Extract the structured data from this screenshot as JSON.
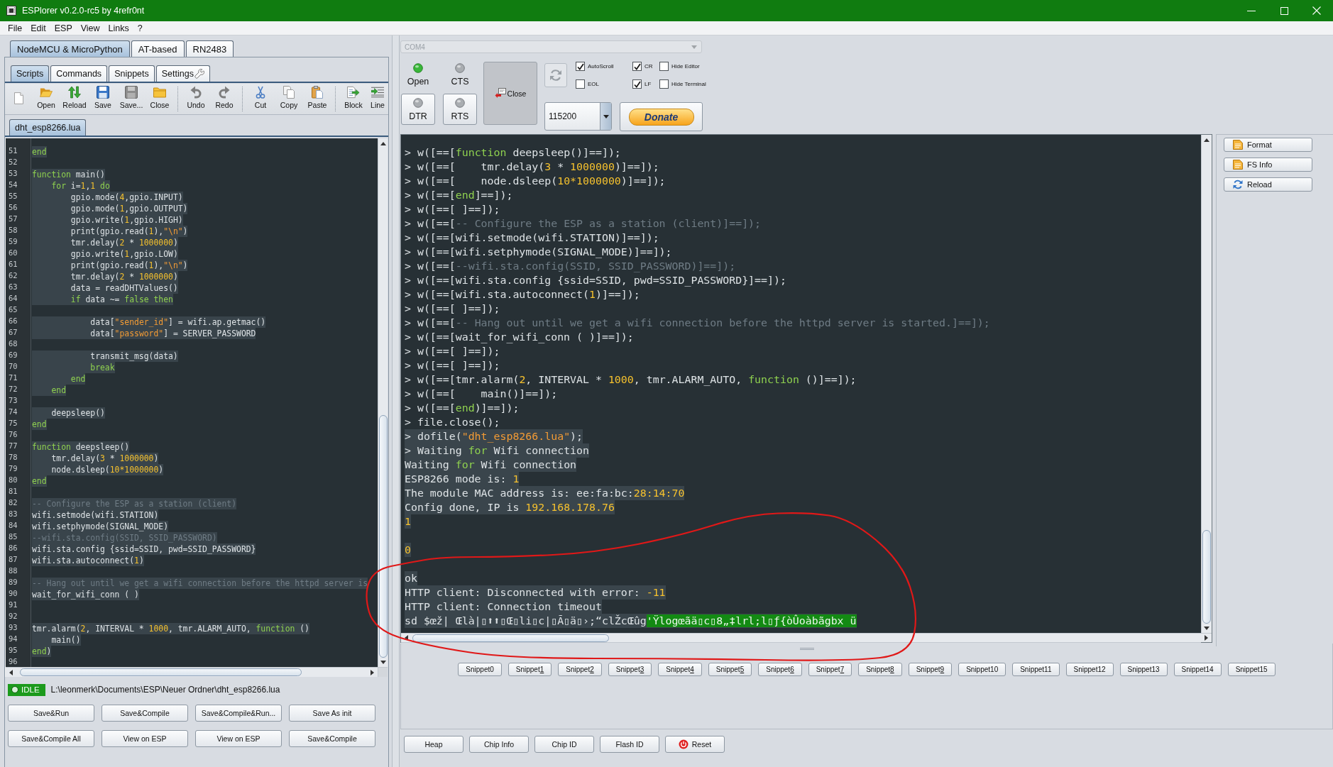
{
  "window": {
    "title": "ESPlorer v0.2.0-rc5 by 4refr0nt"
  },
  "menu": [
    "File",
    "Edit",
    "ESP",
    "View",
    "Links",
    "?"
  ],
  "firmware_tabs": [
    {
      "label": "NodeMCU & MicroPython",
      "selected": true
    },
    {
      "label": "AT-based",
      "selected": false
    },
    {
      "label": "RN2483",
      "selected": false
    }
  ],
  "editor_tabs": [
    {
      "label": "Scripts",
      "selected": true,
      "kind": "text"
    },
    {
      "label": "Commands",
      "selected": false,
      "kind": "text"
    },
    {
      "label": "Snippets",
      "selected": false,
      "kind": "text"
    },
    {
      "label": "Settings",
      "selected": false,
      "kind": "icon"
    }
  ],
  "toolbar": [
    [
      "Open",
      "Reload",
      "Save",
      "Save...",
      "Close"
    ],
    [
      "Undo",
      "Redo"
    ],
    [
      "Cut",
      "Copy",
      "Paste"
    ],
    [
      "Block",
      "Line"
    ]
  ],
  "file_tabs": [
    {
      "label": "dht_esp8266.lua",
      "selected": true
    }
  ],
  "editor": {
    "lines": [
      {
        "number": "51",
        "tokens": [
          {
            "kind": "keyword",
            "text": "end"
          }
        ]
      },
      {
        "number": "52"
      },
      {
        "number": "53",
        "tokens": [
          {
            "kind": "keyword",
            "text": "function"
          },
          {
            "kind": "plain",
            "text": " main()"
          }
        ]
      },
      {
        "number": "54",
        "tokens": [
          {
            "kind": "keyword",
            "text": "    for"
          },
          {
            "kind": "plain",
            "text": " i="
          },
          {
            "kind": "number",
            "text": "1"
          },
          {
            "kind": "plain",
            "text": ","
          },
          {
            "kind": "number",
            "text": "1"
          },
          {
            "kind": "keyword",
            "text": " do"
          }
        ]
      },
      {
        "number": "55",
        "tokens": [
          {
            "kind": "plain",
            "text": "        gpio.mode("
          },
          {
            "kind": "number",
            "text": "4"
          },
          {
            "kind": "plain",
            "text": ",gpio.INPUT)"
          }
        ]
      },
      {
        "number": "56",
        "tokens": [
          {
            "kind": "plain",
            "text": "        gpio.mode("
          },
          {
            "kind": "number",
            "text": "1"
          },
          {
            "kind": "plain",
            "text": ",gpio.OUTPUT)"
          }
        ]
      },
      {
        "number": "57",
        "tokens": [
          {
            "kind": "plain",
            "text": "        gpio.write("
          },
          {
            "kind": "number",
            "text": "1"
          },
          {
            "kind": "plain",
            "text": ",gpio.HIGH)"
          }
        ]
      },
      {
        "number": "58",
        "tokens": [
          {
            "kind": "plain",
            "text": "        print(gpio.read("
          },
          {
            "kind": "number",
            "text": "1"
          },
          {
            "kind": "plain",
            "text": "),"
          },
          {
            "kind": "string",
            "text": "\"\\n\""
          },
          {
            "kind": "plain",
            "text": ")"
          }
        ]
      },
      {
        "number": "59",
        "tokens": [
          {
            "kind": "plain",
            "text": "        tmr.delay("
          },
          {
            "kind": "number",
            "text": "2"
          },
          {
            "kind": "plain",
            "text": " * "
          },
          {
            "kind": "number",
            "text": "1000000"
          },
          {
            "kind": "plain",
            "text": ")"
          }
        ]
      },
      {
        "number": "60",
        "tokens": [
          {
            "kind": "plain",
            "text": "        gpio.write("
          },
          {
            "kind": "number",
            "text": "1"
          },
          {
            "kind": "plain",
            "text": ",gpio.LOW)"
          }
        ]
      },
      {
        "number": "61",
        "tokens": [
          {
            "kind": "plain",
            "text": "        print(gpio.read("
          },
          {
            "kind": "number",
            "text": "1"
          },
          {
            "kind": "plain",
            "text": "),"
          },
          {
            "kind": "string",
            "text": "\"\\n\""
          },
          {
            "kind": "plain",
            "text": ")"
          }
        ]
      },
      {
        "number": "62",
        "tokens": [
          {
            "kind": "plain",
            "text": "        tmr.delay("
          },
          {
            "kind": "number",
            "text": "2"
          },
          {
            "kind": "plain",
            "text": " * "
          },
          {
            "kind": "number",
            "text": "1000000"
          },
          {
            "kind": "plain",
            "text": ")"
          }
        ]
      },
      {
        "number": "63",
        "tokens": [
          {
            "kind": "plain",
            "text": "        data = readDHTValues()"
          }
        ]
      },
      {
        "number": "64",
        "tokens": [
          {
            "kind": "keyword",
            "text": "        if"
          },
          {
            "kind": "plain",
            "text": " data ~= "
          },
          {
            "kind": "keyword",
            "text": "false"
          },
          {
            "kind": "keyword",
            "text": " then"
          }
        ]
      },
      {
        "number": "65"
      },
      {
        "number": "66",
        "tokens": [
          {
            "kind": "plain",
            "text": "            data["
          },
          {
            "kind": "string",
            "text": "\"sender_id\""
          },
          {
            "kind": "plain",
            "text": "] = wifi.ap.getmac()"
          }
        ]
      },
      {
        "number": "67",
        "tokens": [
          {
            "kind": "plain",
            "text": "            data["
          },
          {
            "kind": "string",
            "text": "\"password\""
          },
          {
            "kind": "plain",
            "text": "] = SERVER_PASSWORD"
          }
        ]
      },
      {
        "number": "68"
      },
      {
        "number": "69",
        "tokens": [
          {
            "kind": "plain",
            "text": "            transmit_msg(data)"
          }
        ]
      },
      {
        "number": "70",
        "tokens": [
          {
            "kind": "keyword",
            "text": "            break"
          }
        ]
      },
      {
        "number": "71",
        "tokens": [
          {
            "kind": "keyword",
            "text": "        end"
          }
        ]
      },
      {
        "number": "72",
        "tokens": [
          {
            "kind": "keyword",
            "text": "    end"
          }
        ]
      },
      {
        "number": "73"
      },
      {
        "number": "74",
        "tokens": [
          {
            "kind": "plain",
            "text": "    deepsleep()"
          }
        ]
      },
      {
        "number": "75",
        "tokens": [
          {
            "kind": "keyword",
            "text": "end"
          }
        ]
      },
      {
        "number": "76"
      },
      {
        "number": "77",
        "tokens": [
          {
            "kind": "keyword",
            "text": "function"
          },
          {
            "kind": "plain",
            "text": " deepsleep()"
          }
        ]
      },
      {
        "number": "78",
        "tokens": [
          {
            "kind": "plain",
            "text": "    tmr.delay("
          },
          {
            "kind": "number",
            "text": "3"
          },
          {
            "kind": "plain",
            "text": " * "
          },
          {
            "kind": "number",
            "text": "1000000"
          },
          {
            "kind": "plain",
            "text": ")"
          }
        ]
      },
      {
        "number": "79",
        "tokens": [
          {
            "kind": "plain",
            "text": "    node.dsleep("
          },
          {
            "kind": "number",
            "text": "10*1000000"
          },
          {
            "kind": "plain",
            "text": ")"
          }
        ]
      },
      {
        "number": "80",
        "tokens": [
          {
            "kind": "keyword",
            "text": "end"
          }
        ]
      },
      {
        "number": "81"
      },
      {
        "number": "82",
        "tokens": [
          {
            "kind": "comment",
            "text": "-- Configure the ESP as a station (client)"
          }
        ]
      },
      {
        "number": "83",
        "tokens": [
          {
            "kind": "plain",
            "text": "wifi.setmode(wifi.STATION)"
          }
        ]
      },
      {
        "number": "84",
        "tokens": [
          {
            "kind": "plain",
            "text": "wifi.setphymode(SIGNAL_MODE)"
          }
        ]
      },
      {
        "number": "85",
        "tokens": [
          {
            "kind": "comment",
            "text": "--wifi.sta.config(SSID, SSID_PASSWORD)"
          }
        ]
      },
      {
        "number": "86",
        "tokens": [
          {
            "kind": "plain",
            "text": "wifi.sta.config {ssid=SSID, pwd=SSID_PASSWORD}"
          }
        ]
      },
      {
        "number": "87",
        "tokens": [
          {
            "kind": "plain",
            "text": "wifi.sta.autoconnect("
          },
          {
            "kind": "number",
            "text": "1"
          },
          {
            "kind": "plain",
            "text": ")"
          }
        ]
      },
      {
        "number": "88"
      },
      {
        "number": "89",
        "tokens": [
          {
            "kind": "comment",
            "text": "-- Hang out until we get a wifi connection before the httpd server is"
          }
        ]
      },
      {
        "number": "90",
        "tokens": [
          {
            "kind": "plain",
            "text": "wait_for_wifi_conn ( )"
          }
        ]
      },
      {
        "number": "91"
      },
      {
        "number": "92"
      },
      {
        "number": "93",
        "tokens": [
          {
            "kind": "plain",
            "text": "tmr.alarm("
          },
          {
            "kind": "number",
            "text": "2"
          },
          {
            "kind": "plain",
            "text": ", INTERVAL * "
          },
          {
            "kind": "number",
            "text": "1000"
          },
          {
            "kind": "plain",
            "text": ", tmr.ALARM_AUTO, "
          },
          {
            "kind": "keyword",
            "text": "function"
          },
          {
            "kind": "plain",
            "text": " ()"
          }
        ]
      },
      {
        "number": "94",
        "tokens": [
          {
            "kind": "plain",
            "text": "    main()"
          }
        ]
      },
      {
        "number": "95",
        "tokens": [
          {
            "kind": "keyword",
            "text": "end"
          },
          {
            "kind": "plain",
            "text": ")"
          }
        ]
      },
      {
        "number": "96"
      }
    ]
  },
  "status": {
    "state": "IDLE",
    "path": "L:\\leonmerk\\Documents\\ESP\\Neuer Ordner\\dht_esp8266.lua"
  },
  "script_buttons": [
    "Save&Run",
    "Save&Compile",
    "Save&Compile&Run...",
    "Save As init",
    "Save&Compile All",
    "View on ESP",
    "View on ESP",
    "Save&Compile"
  ],
  "port": {
    "value": "COM4",
    "disabled": true
  },
  "signals": [
    {
      "label": "Open",
      "on": true
    },
    {
      "label": "CTS",
      "on": false
    }
  ],
  "line_buttons": [
    {
      "label": "DTR",
      "on": false
    },
    {
      "label": "RTS",
      "on": false
    }
  ],
  "connect_button": {
    "label": "Close"
  },
  "options": [
    {
      "label": "AutoScroll",
      "checked": true
    },
    {
      "label": "EOL",
      "checked": false
    },
    {
      "label": "CR",
      "checked": true
    },
    {
      "label": "LF",
      "checked": true
    },
    {
      "label": "Hide Editor",
      "checked": false
    },
    {
      "label": "Hide Terminal",
      "checked": false
    }
  ],
  "baud": {
    "value": "115200"
  },
  "donate": {
    "label": "Donate"
  },
  "terminal": {
    "lines": [
      {
        "kind": "text",
        "highlighted": false,
        "tokens": [
          {
            "kind": "plain",
            "text": "> w([==["
          },
          {
            "kind": "keyword",
            "text": "function"
          },
          {
            "kind": "plain",
            "text": " deepsleep()]==]);"
          }
        ]
      },
      {
        "kind": "text",
        "highlighted": false,
        "tokens": [
          {
            "kind": "plain",
            "text": "> w([==[    tmr.delay("
          },
          {
            "kind": "number",
            "text": "3"
          },
          {
            "kind": "plain",
            "text": " * "
          },
          {
            "kind": "number",
            "text": "1000000"
          },
          {
            "kind": "plain",
            "text": ")]==]);"
          }
        ]
      },
      {
        "kind": "text",
        "highlighted": false,
        "tokens": [
          {
            "kind": "plain",
            "text": "> w([==[    node.dsleep("
          },
          {
            "kind": "number",
            "text": "10*1000000"
          },
          {
            "kind": "plain",
            "text": ")]==]);"
          }
        ]
      },
      {
        "kind": "text",
        "highlighted": false,
        "tokens": [
          {
            "kind": "plain",
            "text": "> w([==["
          },
          {
            "kind": "keyword",
            "text": "end"
          },
          {
            "kind": "plain",
            "text": "]==]);"
          }
        ]
      },
      {
        "kind": "text",
        "highlighted": false,
        "tokens": [
          {
            "kind": "plain",
            "text": "> w([==[ ]==]);"
          }
        ]
      },
      {
        "kind": "text",
        "highlighted": false,
        "tokens": [
          {
            "kind": "plain",
            "text": "> w([==["
          },
          {
            "kind": "comment",
            "text": "-- Configure the ESP as a station (client)]==]);"
          }
        ]
      },
      {
        "kind": "text",
        "highlighted": false,
        "tokens": [
          {
            "kind": "plain",
            "text": "> w([==[wifi.setmode(wifi.STATION)]==]);"
          }
        ]
      },
      {
        "kind": "text",
        "highlighted": false,
        "tokens": [
          {
            "kind": "plain",
            "text": "> w([==[wifi.setphymode(SIGNAL_MODE)]==]);"
          }
        ]
      },
      {
        "kind": "text",
        "highlighted": false,
        "tokens": [
          {
            "kind": "plain",
            "text": "> w([==["
          },
          {
            "kind": "comment",
            "text": "--wifi.sta.config(SSID, SSID_PASSWORD)]==]);"
          }
        ]
      },
      {
        "kind": "text",
        "highlighted": false,
        "tokens": [
          {
            "kind": "plain",
            "text": "> w([==[wifi.sta.config {ssid=SSID, pwd=SSID_PASSWORD}]==]);"
          }
        ]
      },
      {
        "kind": "text",
        "highlighted": false,
        "tokens": [
          {
            "kind": "plain",
            "text": "> w([==[wifi.sta.autoconnect("
          },
          {
            "kind": "number",
            "text": "1"
          },
          {
            "kind": "plain",
            "text": ")]==]);"
          }
        ]
      },
      {
        "kind": "text",
        "highlighted": false,
        "tokens": [
          {
            "kind": "plain",
            "text": "> w([==[ ]==]);"
          }
        ]
      },
      {
        "kind": "text",
        "highlighted": false,
        "tokens": [
          {
            "kind": "plain",
            "text": "> w([==["
          },
          {
            "kind": "comment",
            "text": "-- Hang out until we get a wifi connection before the httpd server is started.]==]);"
          }
        ]
      },
      {
        "kind": "text",
        "highlighted": false,
        "tokens": [
          {
            "kind": "plain",
            "text": "> w([==[wait_for_wifi_conn ( )]==]);"
          }
        ]
      },
      {
        "kind": "text",
        "highlighted": false,
        "tokens": [
          {
            "kind": "plain",
            "text": "> w([==[ ]==]);"
          }
        ]
      },
      {
        "kind": "text",
        "highlighted": false,
        "tokens": [
          {
            "kind": "plain",
            "text": "> w([==[ ]==]);"
          }
        ]
      },
      {
        "kind": "text",
        "highlighted": false,
        "tokens": [
          {
            "kind": "plain",
            "text": "> w([==[tmr.alarm("
          },
          {
            "kind": "number",
            "text": "2"
          },
          {
            "kind": "plain",
            "text": ", INTERVAL * "
          },
          {
            "kind": "number",
            "text": "1000"
          },
          {
            "kind": "plain",
            "text": ", tmr.ALARM_AUTO, "
          },
          {
            "kind": "keyword",
            "text": "function"
          },
          {
            "kind": "plain",
            "text": " ()]==]);"
          }
        ]
      },
      {
        "kind": "text",
        "highlighted": false,
        "tokens": [
          {
            "kind": "plain",
            "text": "> w([==[    main()]==]);"
          }
        ]
      },
      {
        "kind": "text",
        "highlighted": false,
        "tokens": [
          {
            "kind": "plain",
            "text": "> w([==["
          },
          {
            "kind": "keyword",
            "text": "end"
          },
          {
            "kind": "plain",
            "text": ")]==]);"
          }
        ]
      },
      {
        "kind": "text",
        "highlighted": false,
        "tokens": [
          {
            "kind": "plain",
            "text": "> file.close();"
          }
        ]
      },
      {
        "kind": "text",
        "highlighted": true,
        "tokens": [
          {
            "kind": "plain",
            "text": "> dofile("
          },
          {
            "kind": "string",
            "text": "\"dht_esp8266.lua\""
          },
          {
            "kind": "plain",
            "text": ");"
          }
        ]
      },
      {
        "kind": "text",
        "highlighted": true,
        "tokens": [
          {
            "kind": "plain",
            "text": "> Waiting "
          },
          {
            "kind": "keyword",
            "text": "for"
          },
          {
            "kind": "plain",
            "text": " Wifi connection"
          }
        ]
      },
      {
        "kind": "text",
        "highlighted": true,
        "tokens": [
          {
            "kind": "plain",
            "text": "Waiting "
          },
          {
            "kind": "keyword",
            "text": "for"
          },
          {
            "kind": "plain",
            "text": " Wifi connection"
          }
        ]
      },
      {
        "kind": "text",
        "highlighted": true,
        "tokens": [
          {
            "kind": "plain",
            "text": "ESP8266 mode is: "
          },
          {
            "kind": "number",
            "text": "1"
          }
        ]
      },
      {
        "kind": "text",
        "highlighted": true,
        "tokens": [
          {
            "kind": "plain",
            "text": "The module MAC address is: ee:fa:bc:"
          },
          {
            "kind": "number",
            "text": "28:14:70"
          }
        ]
      },
      {
        "kind": "text",
        "highlighted": true,
        "tokens": [
          {
            "kind": "plain",
            "text": "Config done, IP is "
          },
          {
            "kind": "number",
            "text": "192.168.178.76"
          }
        ]
      },
      {
        "kind": "text",
        "highlighted": true,
        "tokens": [
          {
            "kind": "number",
            "text": "1"
          }
        ]
      },
      {
        "kind": "blank"
      },
      {
        "kind": "text",
        "highlighted": true,
        "tokens": [
          {
            "kind": "number",
            "text": "0"
          }
        ]
      },
      {
        "kind": "blank"
      },
      {
        "kind": "text",
        "highlighted": true,
        "tokens": [
          {
            "kind": "plain",
            "text": "ok"
          }
        ]
      },
      {
        "kind": "text",
        "highlighted": true,
        "tokens": [
          {
            "kind": "plain",
            "text": "HTTP client: Disconnected with error: "
          },
          {
            "kind": "number",
            "text": "-11"
          }
        ]
      },
      {
        "kind": "text",
        "highlighted": true,
        "tokens": [
          {
            "kind": "plain",
            "text": "HTTP client: Connection timeout"
          }
        ]
      },
      {
        "kind": "text",
        "highlighted": true,
        "tokens": [
          {
            "kind": "plain",
            "text": "sd $œž| Œlà|▯⬆⬆▯Œ▯li▯c|▯Ã▯ä▯›;“clŽcŒûg"
          },
          {
            "kind": "selection",
            "text": "'Ÿlogœãä▯c▯8„‡lrl;l▯ƒ{òÛoàbãgbx ü"
          }
        ]
      }
    ]
  },
  "side_buttons": [
    "Format",
    "FS Info",
    "Reload"
  ],
  "snippets": [
    {
      "label": "Snippet0",
      "mnemonic": false
    },
    {
      "label": "Snippet1",
      "mnemonic": true
    },
    {
      "label": "Snippet2",
      "mnemonic": true
    },
    {
      "label": "Snippet3",
      "mnemonic": true
    },
    {
      "label": "Snippet4",
      "mnemonic": true
    },
    {
      "label": "Snippet5",
      "mnemonic": true
    },
    {
      "label": "Snippet6",
      "mnemonic": true
    },
    {
      "label": "Snippet7",
      "mnemonic": true
    },
    {
      "label": "Snippet8",
      "mnemonic": true
    },
    {
      "label": "Snippet9",
      "mnemonic": true
    },
    {
      "label": "Snippet10",
      "mnemonic": false
    },
    {
      "label": "Snippet11",
      "mnemonic": false
    },
    {
      "label": "Snippet12",
      "mnemonic": false
    },
    {
      "label": "Snippet13",
      "mnemonic": false
    },
    {
      "label": "Snippet14",
      "mnemonic": false
    },
    {
      "label": "Snippet15",
      "mnemonic": false
    }
  ],
  "device_buttons": [
    {
      "label": "Heap",
      "kind": "plain"
    },
    {
      "label": "Chip Info",
      "kind": "plain"
    },
    {
      "label": "Chip ID",
      "kind": "plain"
    },
    {
      "label": "Flash ID",
      "kind": "plain"
    },
    {
      "label": "Reset",
      "kind": "power"
    }
  ]
}
